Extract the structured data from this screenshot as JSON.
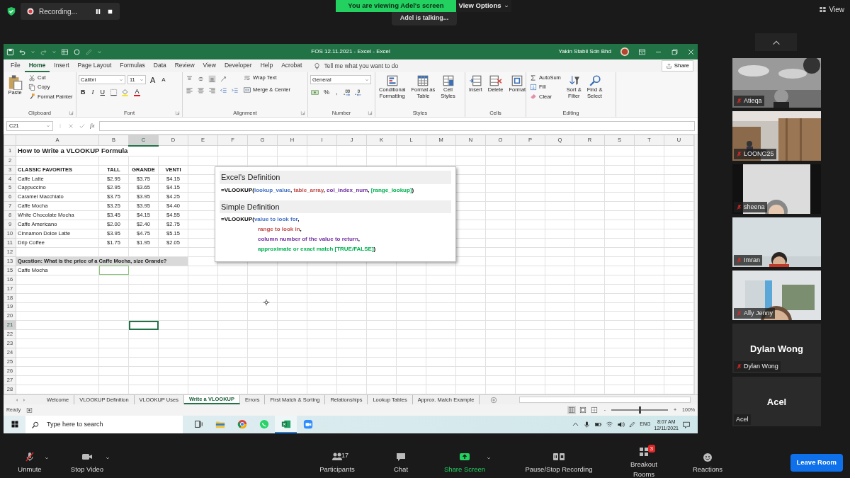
{
  "meeting_bar": {
    "recording": "Recording...",
    "banner": "You are viewing Adel's screen",
    "view_options": "View Options",
    "talking": "Adel is talking...",
    "view": "View"
  },
  "excel": {
    "title": "FOS 12.11.2021  -  Excel  -  Excel",
    "account": "Yakin Stabil Sdn Bhd",
    "tabs": [
      {
        "label": "File",
        "selected": false
      },
      {
        "label": "Home",
        "selected": true
      },
      {
        "label": "Insert",
        "selected": false
      },
      {
        "label": "Page Layout",
        "selected": false
      },
      {
        "label": "Formulas",
        "selected": false
      },
      {
        "label": "Data",
        "selected": false
      },
      {
        "label": "Review",
        "selected": false
      },
      {
        "label": "View",
        "selected": false
      },
      {
        "label": "Developer",
        "selected": false
      },
      {
        "label": "Help",
        "selected": false
      },
      {
        "label": "Acrobat",
        "selected": false
      }
    ],
    "tell_me": "Tell me what you want to do",
    "share": "Share",
    "ribbon_groups": [
      {
        "label": "Clipboard",
        "launcher": true,
        "columns": [
          {
            "kind": "large",
            "label": "Paste"
          },
          {
            "kind": "stack",
            "items": [
              {
                "label": "Cut"
              },
              {
                "label": "Copy"
              },
              {
                "label": "Format Painter"
              }
            ]
          }
        ]
      },
      {
        "label": "Font",
        "launcher": true,
        "columns": [
          {
            "kind": "rows",
            "upper": [
              {
                "kind": "field",
                "value": "Calibri"
              },
              {
                "kind": "field",
                "value": "11"
              },
              {
                "kind": "glyph",
                "text": "A"
              },
              {
                "kind": "glyph",
                "text": "A"
              }
            ],
            "lower": [
              {
                "kind": "glyph",
                "text": "B"
              },
              {
                "kind": "glyph",
                "text": "I"
              },
              {
                "kind": "glyph",
                "text": "U"
              },
              {
                "kind": "icon"
              },
              {
                "kind": "icon"
              },
              {
                "kind": "glyph",
                "text": "A"
              }
            ]
          }
        ]
      },
      {
        "label": "Alignment",
        "launcher": true,
        "columns": [
          {
            "kind": "rows",
            "upper": [
              {
                "kind": "icon"
              },
              {
                "kind": "icon"
              },
              {
                "kind": "icon"
              },
              {
                "kind": "icon"
              }
            ],
            "lower": [
              {
                "kind": "icon"
              },
              {
                "kind": "icon"
              },
              {
                "kind": "icon"
              },
              {
                "kind": "icon"
              },
              {
                "kind": "icon"
              }
            ]
          },
          {
            "kind": "stack",
            "items": [
              {
                "label": "Wrap Text"
              },
              {
                "label": "Merge & Center"
              }
            ]
          }
        ]
      },
      {
        "label": "Number",
        "launcher": true,
        "columns": [
          {
            "kind": "rows",
            "upper": [
              {
                "kind": "field",
                "value": "General"
              }
            ],
            "lower": [
              {
                "kind": "icon"
              },
              {
                "kind": "glyph",
                "text": "%"
              },
              {
                "kind": "glyph",
                "text": ","
              },
              {
                "kind": "icon"
              },
              {
                "kind": "icon"
              }
            ]
          }
        ]
      },
      {
        "label": "Styles",
        "launcher": false,
        "columns": [
          {
            "kind": "large",
            "label": "Conditional\nFormatting"
          },
          {
            "kind": "large",
            "label": "Format as\nTable"
          },
          {
            "kind": "large",
            "label": "Cell\nStyles"
          }
        ]
      },
      {
        "label": "Cells",
        "launcher": false,
        "columns": [
          {
            "kind": "large",
            "label": "Insert"
          },
          {
            "kind": "large",
            "label": "Delete"
          },
          {
            "kind": "large",
            "label": "Format"
          }
        ]
      },
      {
        "label": "Editing",
        "launcher": false,
        "columns": [
          {
            "kind": "stack",
            "items": [
              {
                "label": "AutoSum"
              },
              {
                "label": "Fill"
              },
              {
                "label": "Clear"
              }
            ]
          },
          {
            "kind": "large",
            "label": "Sort &\nFilter"
          },
          {
            "kind": "large",
            "label": "Find &\nSelect"
          }
        ]
      }
    ],
    "name_box": "C21",
    "function_label": "fx",
    "columns": [
      {
        "label": "A",
        "selected": false
      },
      {
        "label": "B",
        "selected": false
      },
      {
        "label": "C",
        "selected": true
      },
      {
        "label": "D",
        "selected": false
      },
      {
        "label": "E",
        "selected": false
      },
      {
        "label": "F",
        "selected": false
      },
      {
        "label": "G",
        "selected": false
      },
      {
        "label": "H",
        "selected": false
      },
      {
        "label": "I",
        "selected": false
      },
      {
        "label": "J",
        "selected": false
      },
      {
        "label": "K",
        "selected": false
      },
      {
        "label": "L",
        "selected": false
      },
      {
        "label": "M",
        "selected": false
      },
      {
        "label": "N",
        "selected": false
      },
      {
        "label": "O",
        "selected": false
      },
      {
        "label": "P",
        "selected": false
      },
      {
        "label": "Q",
        "selected": false
      },
      {
        "label": "R",
        "selected": false
      },
      {
        "label": "S",
        "selected": false
      },
      {
        "label": "T",
        "selected": false
      },
      {
        "label": "U",
        "selected": false
      }
    ],
    "rows": [
      {
        "number": "1",
        "kind": "title",
        "selected": false,
        "cells": [
          "How to Write a VLOOKUP Formula"
        ]
      },
      {
        "number": "2",
        "kind": "blank",
        "selected": false
      },
      {
        "number": "3",
        "kind": "header",
        "selected": false,
        "cells": [
          "CLASSIC FAVORITES",
          "TALL",
          "GRANDE",
          "VENTI"
        ]
      },
      {
        "number": "4",
        "kind": "data",
        "selected": false,
        "cells": [
          "Caffe Latte",
          "$2.95",
          "$3.75",
          "$4.15"
        ]
      },
      {
        "number": "5",
        "kind": "data",
        "selected": false,
        "cells": [
          "Cappuccino",
          "$2.95",
          "$3.65",
          "$4.15"
        ]
      },
      {
        "number": "6",
        "kind": "data",
        "selected": false,
        "cells": [
          "Caramel Macchiato",
          "$3.75",
          "$3.95",
          "$4.25"
        ]
      },
      {
        "number": "7",
        "kind": "data",
        "selected": false,
        "cells": [
          "Caffe Mocha",
          "$3.25",
          "$3.95",
          "$4.40"
        ]
      },
      {
        "number": "8",
        "kind": "data",
        "selected": false,
        "cells": [
          "White Chocolate Mocha",
          "$3.45",
          "$4.15",
          "$4.55"
        ]
      },
      {
        "number": "9",
        "kind": "data",
        "selected": false,
        "cells": [
          "Caffe Americano",
          "$2.00",
          "$2.40",
          "$2.75"
        ]
      },
      {
        "number": "10",
        "kind": "data",
        "selected": false,
        "cells": [
          "Cinnamon Dolce Latte",
          "$3.95",
          "$4.75",
          "$5.15"
        ]
      },
      {
        "number": "11",
        "kind": "data",
        "selected": false,
        "cells": [
          "Drip Coffee",
          "$1.75",
          "$1.95",
          "$2.05"
        ]
      },
      {
        "number": "12",
        "kind": "blank",
        "selected": false
      },
      {
        "number": "13",
        "kind": "question",
        "selected": false,
        "cells": [
          "Question: What is the price of a Caffe Mocha, size Grande?"
        ]
      },
      {
        "number": "15",
        "kind": "answer",
        "selected": false,
        "cells": [
          "Caffe Mocha"
        ]
      },
      {
        "number": "16",
        "kind": "blank",
        "selected": false
      },
      {
        "number": "17",
        "kind": "blank",
        "selected": false
      },
      {
        "number": "18",
        "kind": "blank",
        "selected": false
      },
      {
        "number": "19",
        "kind": "blank",
        "selected": false
      },
      {
        "number": "20",
        "kind": "blank",
        "selected": false
      },
      {
        "number": "21",
        "kind": "blank",
        "selected": true
      },
      {
        "number": "22",
        "kind": "blank",
        "selected": false
      },
      {
        "number": "23",
        "kind": "blank",
        "selected": false
      },
      {
        "number": "24",
        "kind": "blank",
        "selected": false
      },
      {
        "number": "25",
        "kind": "blank",
        "selected": false
      },
      {
        "number": "26",
        "kind": "blank",
        "selected": false
      },
      {
        "number": "27",
        "kind": "blank",
        "selected": false
      },
      {
        "number": "28",
        "kind": "blank",
        "selected": false
      }
    ],
    "definition_box": {
      "sections": [
        {
          "heading": "Excel's Definition",
          "lines": [
            {
              "kind": "start",
              "segments": [
                {
                  "text": "=VLOOKUP("
                },
                {
                  "text": "lookup_value",
                  "color": "#4472c4"
                },
                {
                  "text": ", "
                },
                {
                  "text": "table_array",
                  "color": "#c0504d"
                },
                {
                  "text": ", "
                },
                {
                  "text": "col_index_num",
                  "color": "#7030a0"
                },
                {
                  "text": ", "
                },
                {
                  "text": "[range_lookup]",
                  "color": "#00b050"
                },
                {
                  "text": ")"
                }
              ]
            }
          ]
        },
        {
          "heading": "Simple Definition",
          "lines": [
            {
              "kind": "start",
              "segments": [
                {
                  "text": "=VLOOKUP("
                },
                {
                  "text": "value to look for",
                  "color": "#4472c4"
                },
                {
                  "text": ","
                }
              ]
            },
            {
              "kind": "continued",
              "segments": [
                {
                  "text": "range to look in",
                  "color": "#c0504d"
                },
                {
                  "text": ","
                }
              ]
            },
            {
              "kind": "continued",
              "segments": [
                {
                  "text": "column number of the value to return",
                  "color": "#7030a0"
                },
                {
                  "text": ","
                }
              ]
            },
            {
              "kind": "continued",
              "segments": [
                {
                  "text": "approximate or exact match [TRUE/FALSE]",
                  "color": "#00b050"
                },
                {
                  "text": ")"
                }
              ]
            }
          ]
        }
      ]
    },
    "sheet_tabs": [
      {
        "label": "Welcome",
        "selected": false
      },
      {
        "label": "VLOOKUP Definition",
        "selected": false
      },
      {
        "label": "VLOOKUP Uses",
        "selected": false
      },
      {
        "label": "Write a VLOOKUP",
        "selected": true
      },
      {
        "label": "Errors",
        "selected": false
      },
      {
        "label": "First Match & Sorting",
        "selected": false
      },
      {
        "label": "Relationships",
        "selected": false
      },
      {
        "label": "Lookup Tables",
        "selected": false
      },
      {
        "label": "Approx. Match Example",
        "selected": false
      }
    ],
    "status": "Ready",
    "views": [
      {
        "kind": "normal",
        "selected": true
      },
      {
        "kind": "page_layout",
        "selected": false
      },
      {
        "kind": "page_break",
        "selected": false
      }
    ],
    "zoom_out": "-",
    "zoom_slider": {
      "level": 0.5
    },
    "zoom_in": "+",
    "zoom": "100%"
  },
  "taskbar": {
    "search_placeholder": "Type here to search",
    "apps": [
      {
        "kind": "task_view",
        "selected": false
      },
      {
        "kind": "folder",
        "selected": false
      },
      {
        "kind": "chrome",
        "selected": false
      },
      {
        "kind": "whatsapp",
        "selected": false
      },
      {
        "kind": "excel",
        "selected": true
      },
      {
        "kind": "zoom",
        "selected": false
      }
    ],
    "language": "ENG",
    "time": "8:07 AM",
    "date": "12/11/2021"
  },
  "participants": [
    {
      "name": "Atieqa",
      "kind": "video",
      "muted": true
    },
    {
      "name": "LOONG25",
      "kind": "video",
      "muted": true
    },
    {
      "name": "sheena",
      "kind": "video",
      "muted": true
    },
    {
      "name": "Imran",
      "kind": "video",
      "muted": true
    },
    {
      "name": "Ally Jenny",
      "kind": "video",
      "muted": true
    },
    {
      "name": "Dylan Wong",
      "kind": "name",
      "display_name": "Dylan Wong",
      "muted": true
    },
    {
      "name": "Acel",
      "kind": "name",
      "display_name": "Acel",
      "muted": false
    }
  ],
  "toolbar": [
    {
      "label": "Unmute",
      "caret": true,
      "kind": "normal"
    },
    {
      "label": "Stop Video",
      "caret": true,
      "kind": "normal"
    },
    {
      "label": "Participants",
      "count": "17",
      "caret": false,
      "kind": "normal"
    },
    {
      "label": "Chat",
      "caret": false,
      "kind": "normal"
    },
    {
      "label": "Share Screen",
      "caret": true,
      "kind": "share"
    },
    {
      "label": "Pause/Stop Recording",
      "caret": false,
      "kind": "normal"
    },
    {
      "label": "Breakout Rooms",
      "badge": "3",
      "caret": false,
      "kind": "normal"
    },
    {
      "label": "Reactions",
      "caret": false,
      "kind": "normal"
    }
  ],
  "leave": "Leave Room"
}
